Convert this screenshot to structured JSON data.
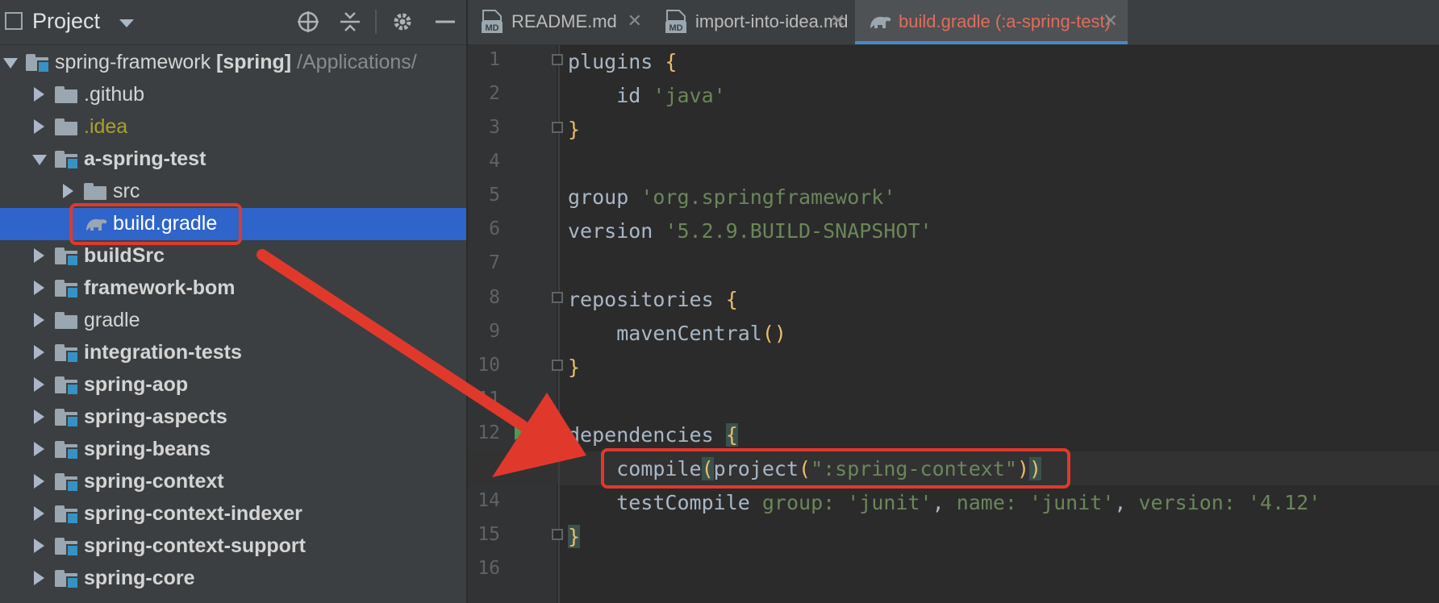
{
  "project_panel": {
    "title": "Project",
    "tree": [
      {
        "label": "spring-framework",
        "suffix": "[spring]",
        "path": "/Applications/",
        "open": true,
        "indent": 0,
        "type": "module",
        "bold": false
      },
      {
        "label": ".github",
        "open": false,
        "indent": 1,
        "type": "folder",
        "bold": false
      },
      {
        "label": ".idea",
        "open": false,
        "indent": 1,
        "type": "folder",
        "bold": false,
        "yellow": true
      },
      {
        "label": "a-spring-test",
        "open": true,
        "indent": 1,
        "type": "module",
        "bold": true
      },
      {
        "label": "src",
        "open": false,
        "indent": 2,
        "type": "folder",
        "bold": false
      },
      {
        "label": "build.gradle",
        "indent": 2,
        "type": "gradle",
        "bold": false,
        "selected": true
      },
      {
        "label": "buildSrc",
        "open": false,
        "indent": 1,
        "type": "module",
        "bold": true
      },
      {
        "label": "framework-bom",
        "open": false,
        "indent": 1,
        "type": "module",
        "bold": true
      },
      {
        "label": "gradle",
        "open": false,
        "indent": 1,
        "type": "folder",
        "bold": false
      },
      {
        "label": "integration-tests",
        "open": false,
        "indent": 1,
        "type": "module",
        "bold": true
      },
      {
        "label": "spring-aop",
        "open": false,
        "indent": 1,
        "type": "module",
        "bold": true
      },
      {
        "label": "spring-aspects",
        "open": false,
        "indent": 1,
        "type": "module",
        "bold": true
      },
      {
        "label": "spring-beans",
        "open": false,
        "indent": 1,
        "type": "module",
        "bold": true
      },
      {
        "label": "spring-context",
        "open": false,
        "indent": 1,
        "type": "module",
        "bold": true
      },
      {
        "label": "spring-context-indexer",
        "open": false,
        "indent": 1,
        "type": "module",
        "bold": true
      },
      {
        "label": "spring-context-support",
        "open": false,
        "indent": 1,
        "type": "module",
        "bold": true
      },
      {
        "label": "spring-core",
        "open": false,
        "indent": 1,
        "type": "module",
        "bold": true
      }
    ]
  },
  "editor_tabs": [
    {
      "label": "README.md",
      "icon": "markdown-icon",
      "active": false
    },
    {
      "label": "import-into-idea.md",
      "icon": "markdown-icon",
      "active": false
    },
    {
      "label": "build.gradle (:a-spring-test)",
      "icon": "gradle-icon",
      "active": true
    }
  ],
  "editor": {
    "current_line": 13,
    "line_numbers": [
      "1",
      "2",
      "3",
      "4",
      "5",
      "6",
      "7",
      "8",
      "9",
      "10",
      "11",
      "12",
      "13",
      "14",
      "15",
      "16"
    ],
    "code": {
      "l1_kw": "plugins",
      "l2_kw": "id",
      "l2_str": "'java'",
      "l5_kw": "group",
      "l5_str": "'org.springframework'",
      "l6_kw": "version",
      "l6_str": "'5.2.9.BUILD-SNAPSHOT'",
      "l8_kw": "repositories",
      "l9_call": "mavenCentral",
      "l12_kw": "dependencies",
      "l13_call": "compile",
      "l13_inner": "project",
      "l13_str": "\":spring-context\"",
      "l14_call": "testCompile",
      "l14_n1": "group:",
      "l14_v1": "'junit'",
      "l14_n2": "name:",
      "l14_v2": "'junit'",
      "l14_n3": "version:",
      "l14_v3": "'4.12'"
    }
  },
  "annotation_color": "#e0392c"
}
